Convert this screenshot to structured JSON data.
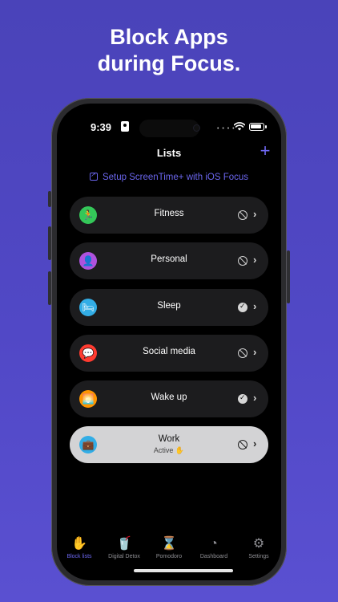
{
  "headline": {
    "line1": "Block Apps",
    "line2": "during Focus."
  },
  "status_bar": {
    "time": "9:39",
    "signal": "• • • •"
  },
  "nav": {
    "title": "Lists",
    "add_icon": "plus-icon",
    "add_symbol": "+"
  },
  "setup_link": {
    "label": "Setup ScreenTime+ with iOS Focus",
    "icon": "external-link-icon"
  },
  "lists": [
    {
      "name": "Fitness",
      "icon": "running-icon",
      "glyph": "🏃",
      "color": "#34c759",
      "state": "blocked"
    },
    {
      "name": "Personal",
      "icon": "person-icon",
      "glyph": "👤",
      "color": "#af52de",
      "state": "blocked"
    },
    {
      "name": "Sleep",
      "icon": "bed-icon",
      "glyph": "🛏",
      "color": "#32ade6",
      "state": "verified"
    },
    {
      "name": "Social media",
      "icon": "speech-bubble-icon",
      "glyph": "💬",
      "color": "#ff3b30",
      "state": "blocked"
    },
    {
      "name": "Wake up",
      "icon": "sunrise-icon",
      "glyph": "🌅",
      "color": "#ff9500",
      "state": "verified"
    },
    {
      "name": "Work",
      "icon": "briefcase-icon",
      "glyph": "💼",
      "color": "#32ade6",
      "state": "blocked",
      "active": true,
      "sublabel": "Active ✋"
    }
  ],
  "tabbar": [
    {
      "label": "Block lists",
      "icon": "hand-icon",
      "glyph": "✋",
      "selected": true
    },
    {
      "label": "Digital Detox",
      "icon": "cup-icon",
      "glyph": "🥤",
      "selected": false
    },
    {
      "label": "Pomodoro",
      "icon": "hourglass-icon",
      "glyph": "⌛",
      "selected": false
    },
    {
      "label": "Dashboard",
      "icon": "pie-chart-icon",
      "glyph": "◔",
      "selected": false
    },
    {
      "label": "Settings",
      "icon": "gear-icon",
      "glyph": "⚙",
      "selected": false
    }
  ],
  "colors": {
    "accent": "#6b66ee",
    "background": "#4a43b9",
    "active_row": "#d3d3d5"
  },
  "chevron": "›"
}
